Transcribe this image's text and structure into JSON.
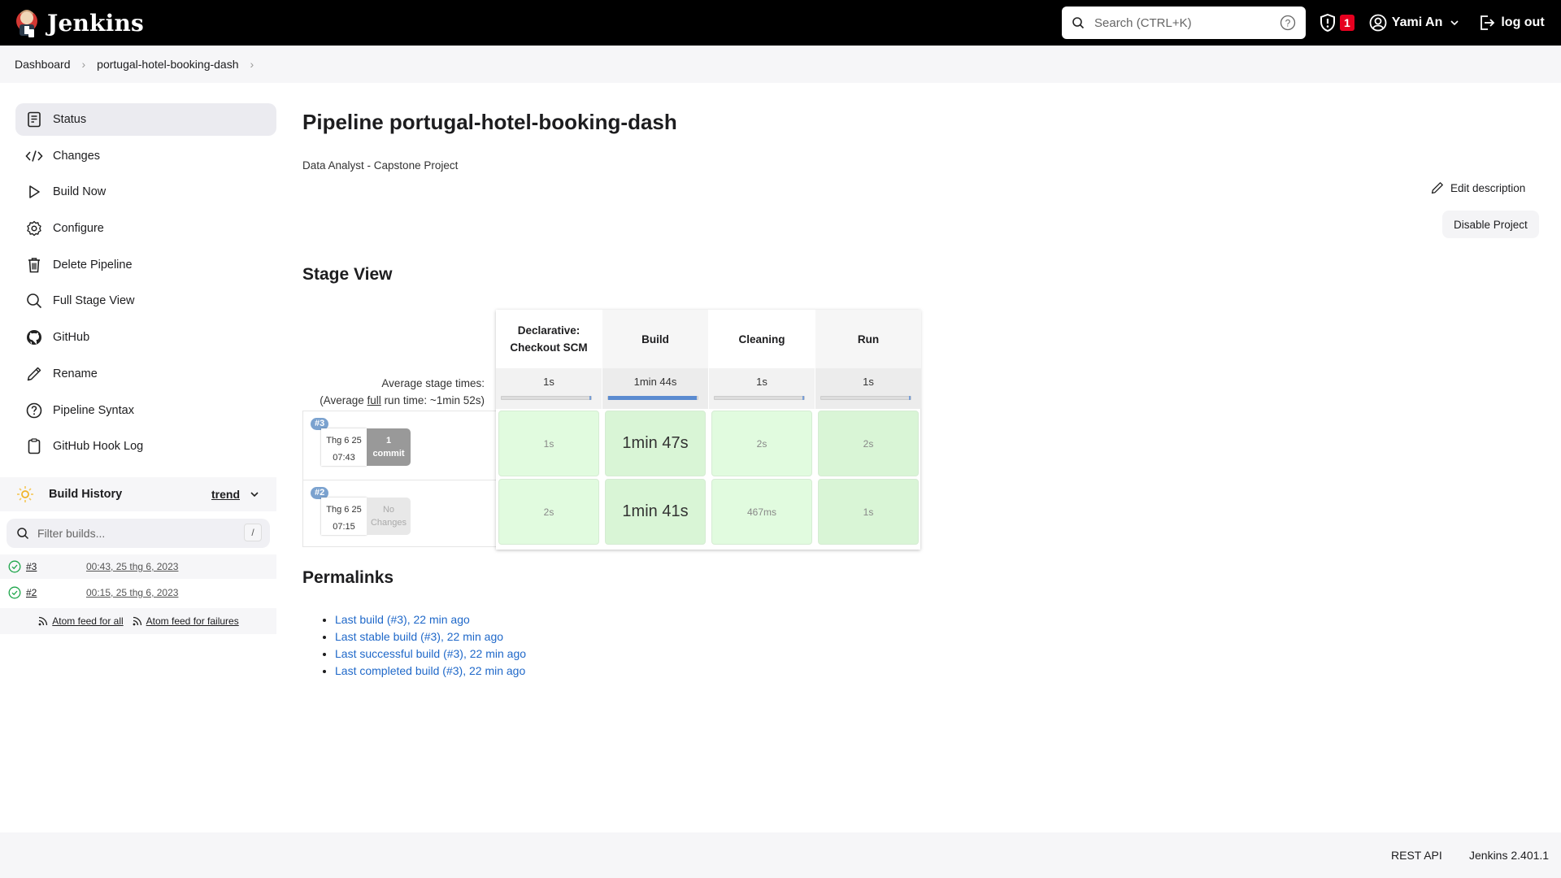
{
  "app": {
    "name": "Jenkins"
  },
  "header": {
    "search_placeholder": "Search (CTRL+K)",
    "security_count": "1",
    "user_name": "Yami An",
    "logout_label": "log out"
  },
  "breadcrumb": [
    "Dashboard",
    "portugal-hotel-booking-dash"
  ],
  "sidebar": {
    "items": [
      {
        "label": "Status",
        "icon": "document-icon",
        "active": true
      },
      {
        "label": "Changes",
        "icon": "code-icon"
      },
      {
        "label": "Build Now",
        "icon": "play-icon"
      },
      {
        "label": "Configure",
        "icon": "gear-icon"
      },
      {
        "label": "Delete Pipeline",
        "icon": "trash-icon"
      },
      {
        "label": "Full Stage View",
        "icon": "search-icon"
      },
      {
        "label": "GitHub",
        "icon": "github-icon"
      },
      {
        "label": "Rename",
        "icon": "pencil-icon"
      },
      {
        "label": "Pipeline Syntax",
        "icon": "help-icon"
      },
      {
        "label": "GitHub Hook Log",
        "icon": "clipboard-icon"
      }
    ]
  },
  "build_history": {
    "title": "Build History",
    "trend_label": "trend",
    "filter_placeholder": "Filter builds...",
    "filter_shortcut": "/",
    "builds": [
      {
        "number": "#3",
        "date": "00:43, 25 thg 6, 2023",
        "status": "success"
      },
      {
        "number": "#2",
        "date": "00:15, 25 thg 6, 2023",
        "status": "success"
      }
    ],
    "feed_all": "Atom feed for all",
    "feed_failures": "Atom feed for failures"
  },
  "main": {
    "title": "Pipeline portugal-hotel-booking-dash",
    "description": "Data Analyst - Capstone Project",
    "edit_description": "Edit description",
    "disable_project": "Disable Project",
    "stage_view_title": "Stage View",
    "avg_label": "Average stage times:",
    "avg_full_prefix": "(Average ",
    "avg_full_link": "full",
    "avg_full_suffix": " run time: ~1min 52s)",
    "stages": [
      {
        "name_line1": "Declarative:",
        "name_line2": "Checkout SCM",
        "avg": "1s",
        "avg_fraction": 0.01
      },
      {
        "name_line1": "Build",
        "name_line2": "",
        "avg": "1min 44s",
        "avg_fraction": 0.97
      },
      {
        "name_line1": "Cleaning",
        "name_line2": "",
        "avg": "1s",
        "avg_fraction": 0.01
      },
      {
        "name_line1": "Run",
        "name_line2": "",
        "avg": "1s",
        "avg_fraction": 0.01
      }
    ],
    "runs": [
      {
        "badge": "#3",
        "date": "Thg 6 25",
        "time": "07:43",
        "changes_line1": "1",
        "changes_line2": "commit",
        "has_changes": true,
        "durations": [
          "1s",
          "1min 47s",
          "2s",
          "2s"
        ]
      },
      {
        "badge": "#2",
        "date": "Thg 6 25",
        "time": "07:15",
        "changes_line1": "No",
        "changes_line2": "Changes",
        "has_changes": false,
        "durations": [
          "2s",
          "1min 41s",
          "467ms",
          "1s"
        ]
      }
    ],
    "permalinks_title": "Permalinks",
    "permalinks": [
      "Last build (#3), 22 min ago",
      "Last stable build (#3), 22 min ago",
      "Last successful build (#3), 22 min ago",
      "Last completed build (#3), 22 min ago"
    ]
  },
  "footer": {
    "rest_api": "REST API",
    "version": "Jenkins 2.401.1"
  },
  "colors": {
    "header_bg": "#000000",
    "link_blue": "#1f68c9",
    "success_green": "#e1fbdf",
    "security_red": "#e6001f",
    "avg_bar_blue": "#5b8bd0"
  }
}
